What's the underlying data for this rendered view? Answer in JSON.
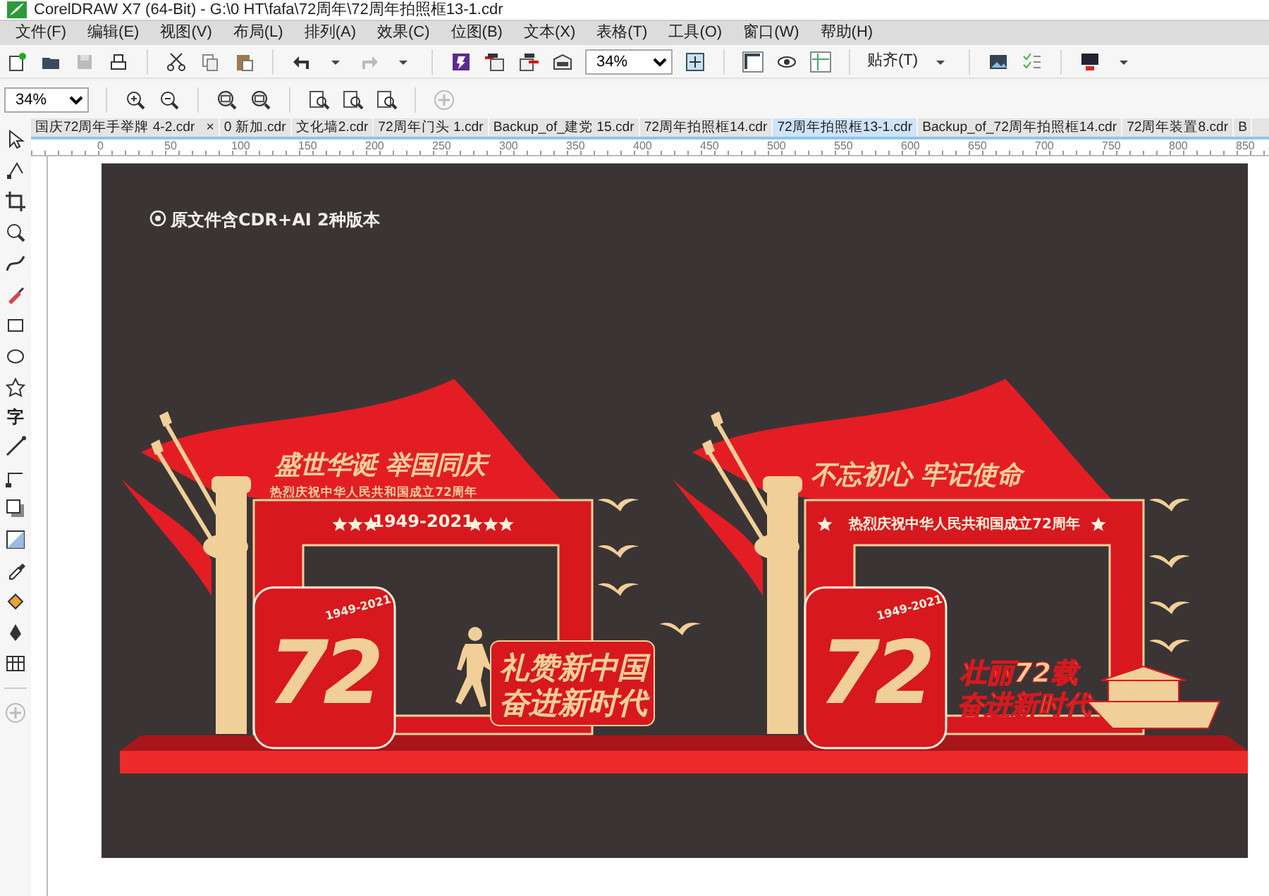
{
  "window": {
    "title": "CorelDRAW X7 (64-Bit) - G:\\0 HT\\fafa\\72周年\\72周年拍照框13-1.cdr"
  },
  "menu": [
    "文件(F)",
    "编辑(E)",
    "视图(V)",
    "布局(L)",
    "排列(A)",
    "效果(C)",
    "位图(B)",
    "文本(X)",
    "表格(T)",
    "工具(O)",
    "窗口(W)",
    "帮助(H)"
  ],
  "standard_toolbar": {
    "zoom": "34%",
    "snap": "贴齐(T)"
  },
  "zoom_toolbar": {
    "zoom": "34%"
  },
  "toolbox": {
    "text_tool": "字"
  },
  "document_tabs": [
    {
      "label": "国庆72周年手举牌 4-2.cdr",
      "close": "×",
      "selected": false
    },
    {
      "label": "0 新加.cdr",
      "selected": false
    },
    {
      "label": "文化墙2.cdr",
      "selected": false
    },
    {
      "label": "72周年门头 1.cdr",
      "selected": false
    },
    {
      "label": "Backup_of_建党 15.cdr",
      "selected": false
    },
    {
      "label": "72周年拍照框14.cdr",
      "selected": false
    },
    {
      "label": "72周年拍照框13-1.cdr",
      "selected": true
    },
    {
      "label": "Backup_of_72周年拍照框14.cdr",
      "selected": false
    },
    {
      "label": "72周年装置8.cdr",
      "selected": false
    },
    {
      "label": "B",
      "selected": false
    }
  ],
  "ruler": {
    "labels": [
      "0",
      "50",
      "100",
      "150",
      "200",
      "250",
      "300",
      "350",
      "400",
      "450",
      "500",
      "550",
      "600",
      "650",
      "700",
      "750",
      "800",
      "850"
    ]
  },
  "canvas": {
    "note": "原文件含CDR+AI 2种版本",
    "frames": [
      {
        "kind": "runner",
        "headline": "盛世华诞 举国同庆",
        "subtitle": "热烈庆祝中华人民共和国成立72周年",
        "years": "1949-2021",
        "number": "72",
        "badge_years": "1949-2021",
        "slogan": [
          "礼赞新中国",
          "奋进新时代"
        ]
      },
      {
        "kind": "boat",
        "headline": "不忘初心 牢记使命",
        "subtitle": "热烈庆祝中华人民共和国成立72周年",
        "number": "72",
        "badge_years": "1949-2021",
        "slogan": [
          "壮丽72载",
          "奋进新时代"
        ]
      }
    ]
  }
}
